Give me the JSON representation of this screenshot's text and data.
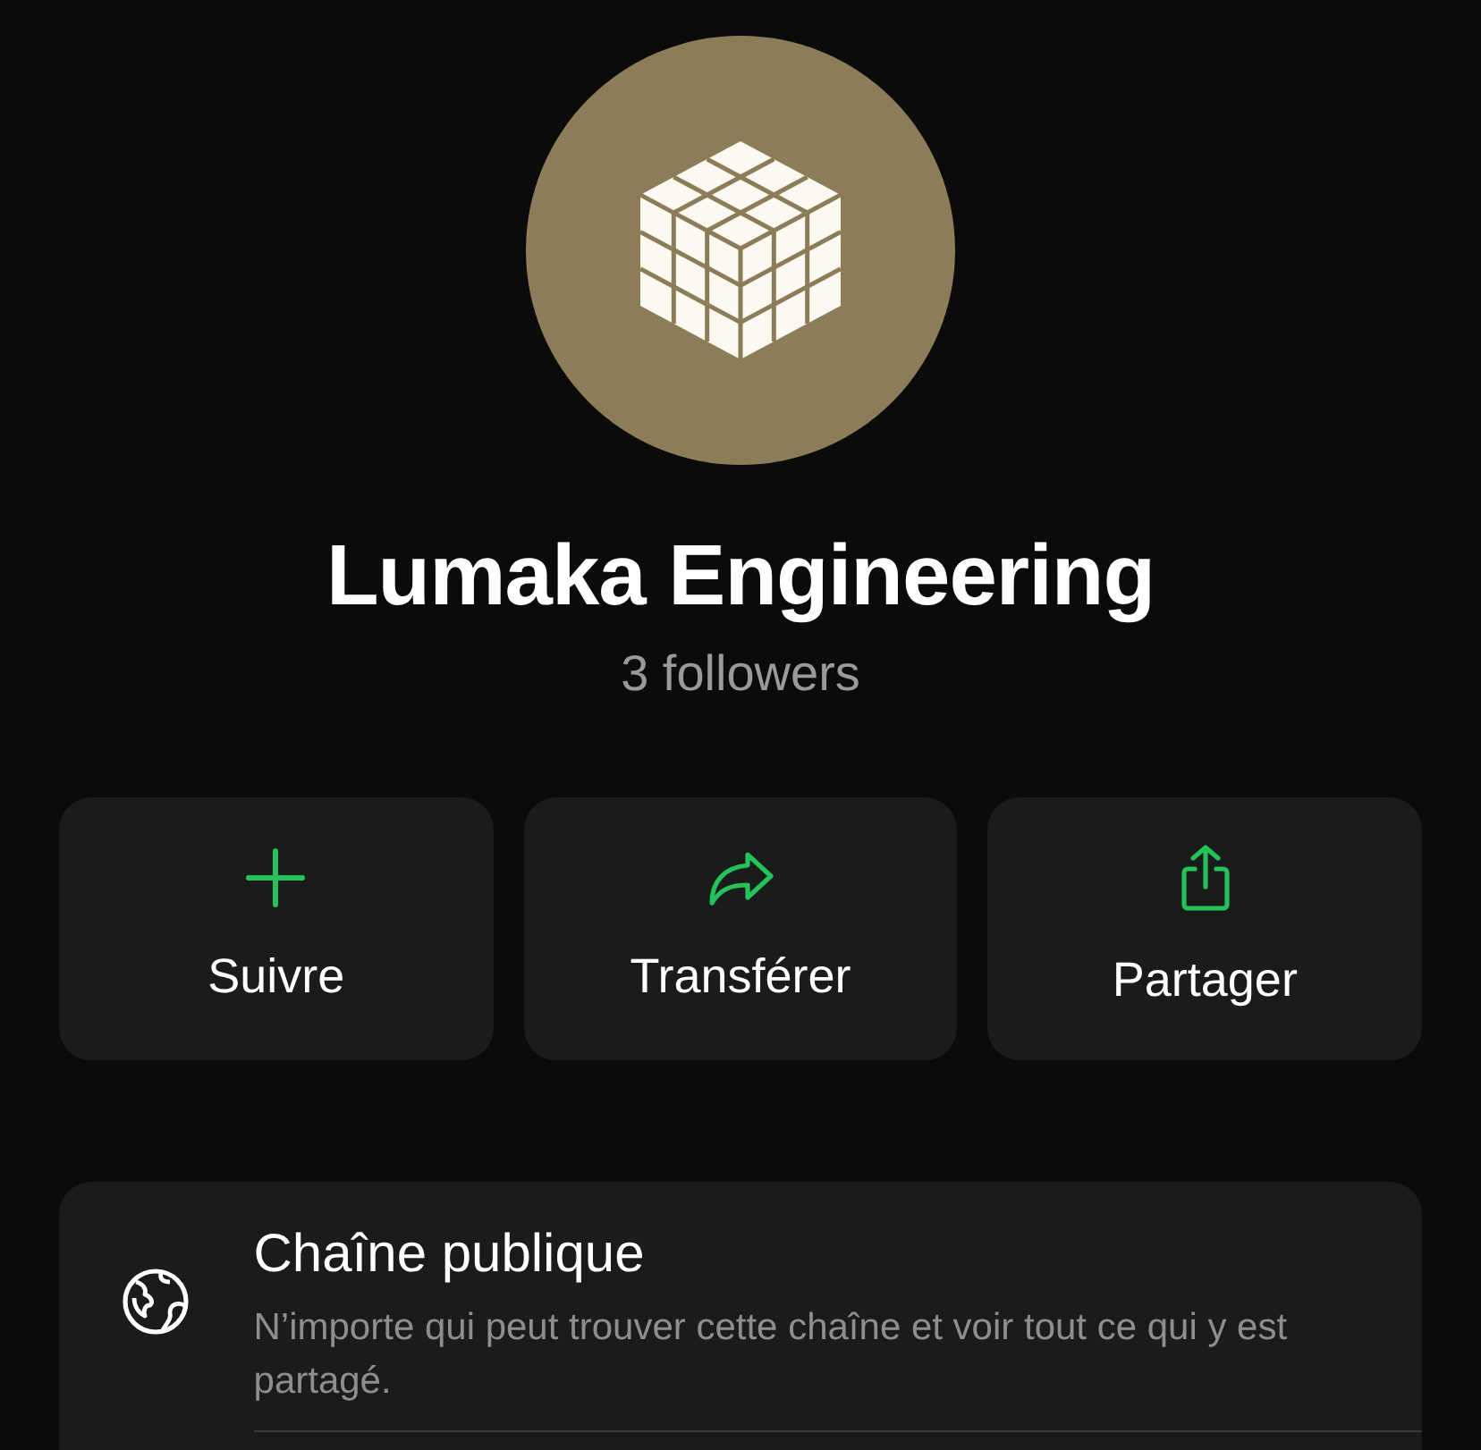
{
  "channel": {
    "name": "Lumaka Engineering",
    "followers": "3 followers"
  },
  "actions": [
    {
      "kind": "follow",
      "label": "Suivre"
    },
    {
      "kind": "forward",
      "label": "Transférer"
    },
    {
      "kind": "share",
      "label": "Partager"
    }
  ],
  "info": {
    "title": "Chaîne publique",
    "description": "N’importe qui peut trouver cette chaîne et voir tout ce qui y est partagé."
  }
}
